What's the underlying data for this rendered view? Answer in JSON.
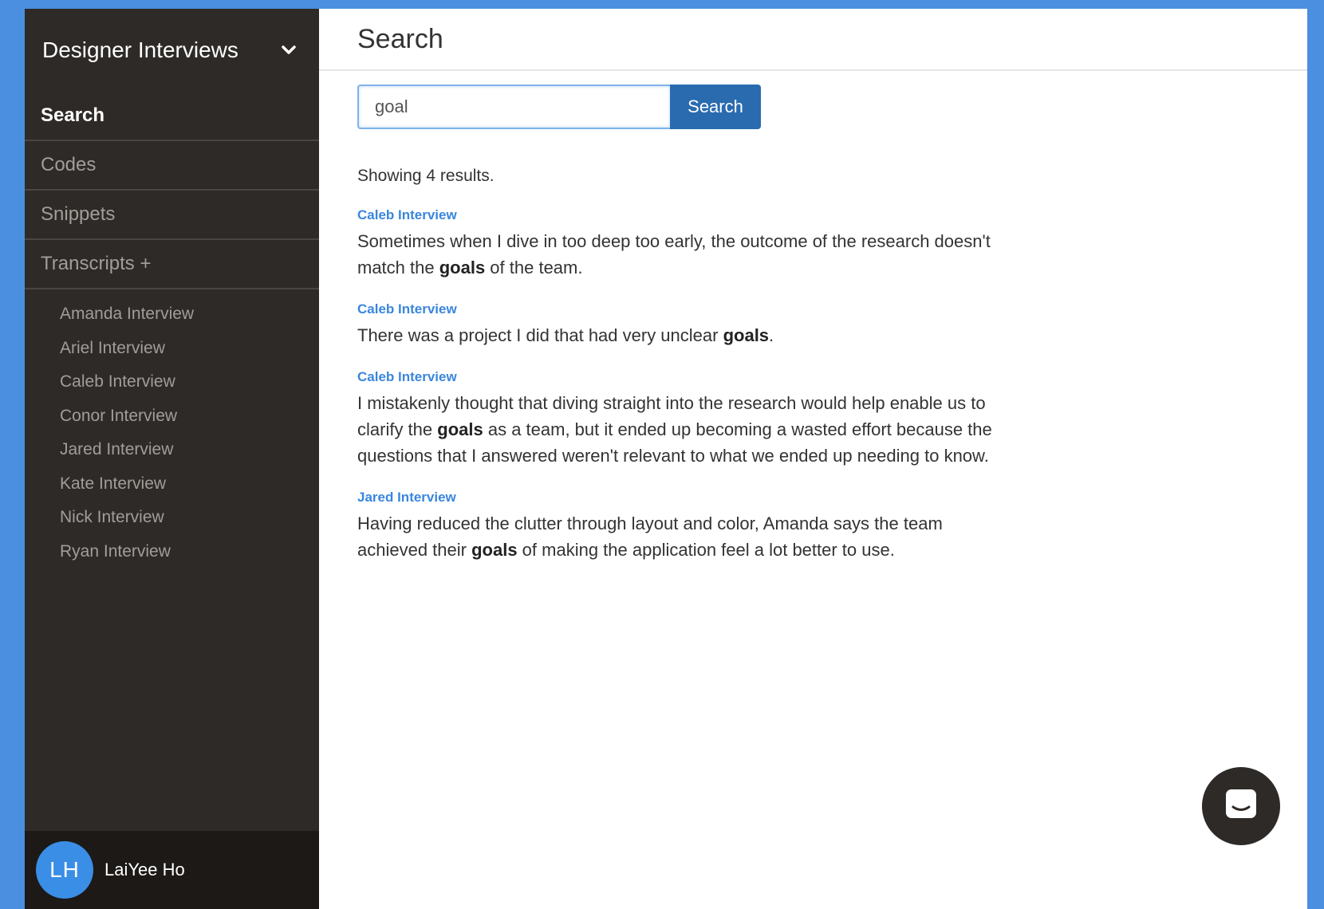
{
  "sidebar": {
    "project_title": "Designer Interviews",
    "nav": [
      {
        "label": "Search"
      },
      {
        "label": "Codes"
      },
      {
        "label": "Snippets"
      },
      {
        "label": "Transcripts +"
      }
    ],
    "transcripts": [
      {
        "label": "Amanda Interview"
      },
      {
        "label": "Ariel Interview"
      },
      {
        "label": "Caleb Interview"
      },
      {
        "label": "Conor Interview"
      },
      {
        "label": "Jared Interview"
      },
      {
        "label": "Kate Interview"
      },
      {
        "label": "Nick Interview"
      },
      {
        "label": "Ryan Interview"
      }
    ],
    "user": {
      "initials": "LH",
      "name": "LaiYee Ho"
    }
  },
  "main": {
    "title": "Search",
    "search": {
      "value": "goal",
      "button_label": "Search"
    },
    "results_count": "Showing 4 results.",
    "results": [
      {
        "source": "Caleb Interview",
        "before": "Sometimes when I dive in too deep too early, the outcome of the research doesn't match the ",
        "match": "goals",
        "after": " of the team."
      },
      {
        "source": "Caleb Interview",
        "before": "There was a project I did that had very unclear ",
        "match": "goals",
        "after": "."
      },
      {
        "source": "Caleb Interview",
        "before": "I mistakenly thought that diving straight into the research would help enable us to clarify the ",
        "match": "goals",
        "after": " as a team, but it ended up becoming a wasted effort because the questions that I answered weren't relevant to what we ended up needing to know."
      },
      {
        "source": "Jared Interview",
        "before": "Having reduced the clutter through layout and color, Amanda says the team achieved their ",
        "match": "goals",
        "after": " of making the application feel a lot better to use."
      }
    ]
  },
  "icons": {
    "dropdown": "chevron-down-icon",
    "chat": "chat-icon"
  },
  "colors": {
    "sidebar_bg": "#2e2a27",
    "accent": "#2a6bb0",
    "link": "#3a86dd",
    "avatar": "#3a8ee6",
    "frame": "#4a8fe0"
  }
}
